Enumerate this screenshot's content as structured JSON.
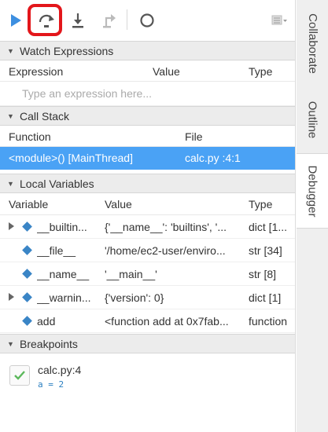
{
  "watch": {
    "title": "Watch Expressions",
    "headers": [
      "Expression",
      "Value",
      "Type"
    ],
    "placeholder": "Type an expression here..."
  },
  "callstack": {
    "title": "Call Stack",
    "headers": [
      "Function",
      "File"
    ],
    "rows": [
      {
        "function": "<module>() [MainThread]",
        "file": "calc.py :4:1"
      }
    ]
  },
  "locals": {
    "title": "Local Variables",
    "headers": [
      "Variable",
      "Value",
      "Type"
    ],
    "rows": [
      {
        "name": "__builtin...",
        "value": "{'__name__': 'builtins', '...",
        "type": "dict [1...",
        "expandable": true
      },
      {
        "name": "__file__",
        "value": "'/home/ec2-user/enviro...",
        "type": "str [34]",
        "expandable": false
      },
      {
        "name": "__name__",
        "value": "'__main__'",
        "type": "str [8]",
        "expandable": false
      },
      {
        "name": "__warnin...",
        "value": "{'version': 0}",
        "type": "dict [1]",
        "expandable": true
      },
      {
        "name": "add",
        "value": "<function add at 0x7fab...",
        "type": "function",
        "expandable": false
      }
    ]
  },
  "breakpoints": {
    "title": "Breakpoints",
    "items": [
      {
        "file": "calc.py:4",
        "code": "a = 2"
      }
    ]
  },
  "sidebar": {
    "tabs": [
      "Collaborate",
      "Outline",
      "Debugger"
    ]
  },
  "colors": {
    "accent": "#4aa2f5",
    "resume": "#3d8fe0",
    "highlight": "#e3161b"
  }
}
